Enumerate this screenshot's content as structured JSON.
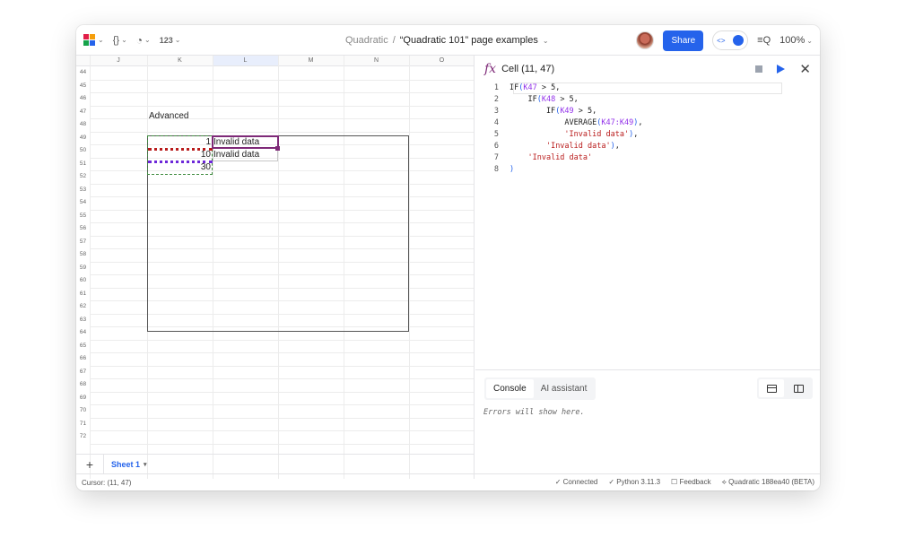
{
  "toolbar": {
    "braces_label": "{}",
    "format_label": "123",
    "breadcrumb_root": "Quadratic",
    "separator": "/",
    "doc_title": "“Quadratic 101” page examples",
    "share_label": "Share",
    "toggle_label": "<>",
    "zoom_icon": "≡Q",
    "zoom": "100%"
  },
  "grid": {
    "columns": [
      "J",
      "K",
      "L",
      "M",
      "N",
      "O"
    ],
    "rows": [
      "44",
      "45",
      "46",
      "47",
      "48",
      "49",
      "50",
      "51",
      "52",
      "53",
      "54",
      "55",
      "56",
      "57",
      "58",
      "59",
      "60",
      "61",
      "62",
      "63",
      "64",
      "65",
      "66",
      "67",
      "68",
      "69",
      "70",
      "71",
      "72"
    ],
    "cells": {
      "k45": "Advanced",
      "k47": "1",
      "l47": "Invalid data",
      "k48": "10",
      "l48": "Invalid data",
      "k49": "30"
    },
    "colors": {
      "selection": "#7e2a78",
      "dots_red": "#b91c1c",
      "dots_purple": "#6d28d9",
      "dash_green": "#3f8b3f"
    }
  },
  "sheets": {
    "add": "+",
    "tab": "Sheet 1",
    "tab_caret": "▾"
  },
  "panel": {
    "fx": "fx",
    "title": "Cell (11, 47)",
    "close": "✕",
    "code_lines": [
      {
        "n": "1",
        "t": "IF(K47 > 5,"
      },
      {
        "n": "2",
        "t": "    IF(K48 > 5,"
      },
      {
        "n": "3",
        "t": "        IF(K49 > 5,"
      },
      {
        "n": "4",
        "t": "            AVERAGE(K47:K49),"
      },
      {
        "n": "5",
        "t": "            'Invalid data'),"
      },
      {
        "n": "6",
        "t": "        'Invalid data'),"
      },
      {
        "n": "7",
        "t": "    'Invalid data'"
      },
      {
        "n": "8",
        "t": ")"
      }
    ],
    "console_tab": "Console",
    "ai_tab": "AI assistant",
    "console_message": "Errors will show here."
  },
  "footer": {
    "cursor": "Cursor: (11, 47)",
    "connected": "✓ Connected",
    "python": "✓ Python 3.11.3",
    "feedback": "☐ Feedback",
    "version": "⟡ Quadratic 188ea40 (BETA)"
  }
}
